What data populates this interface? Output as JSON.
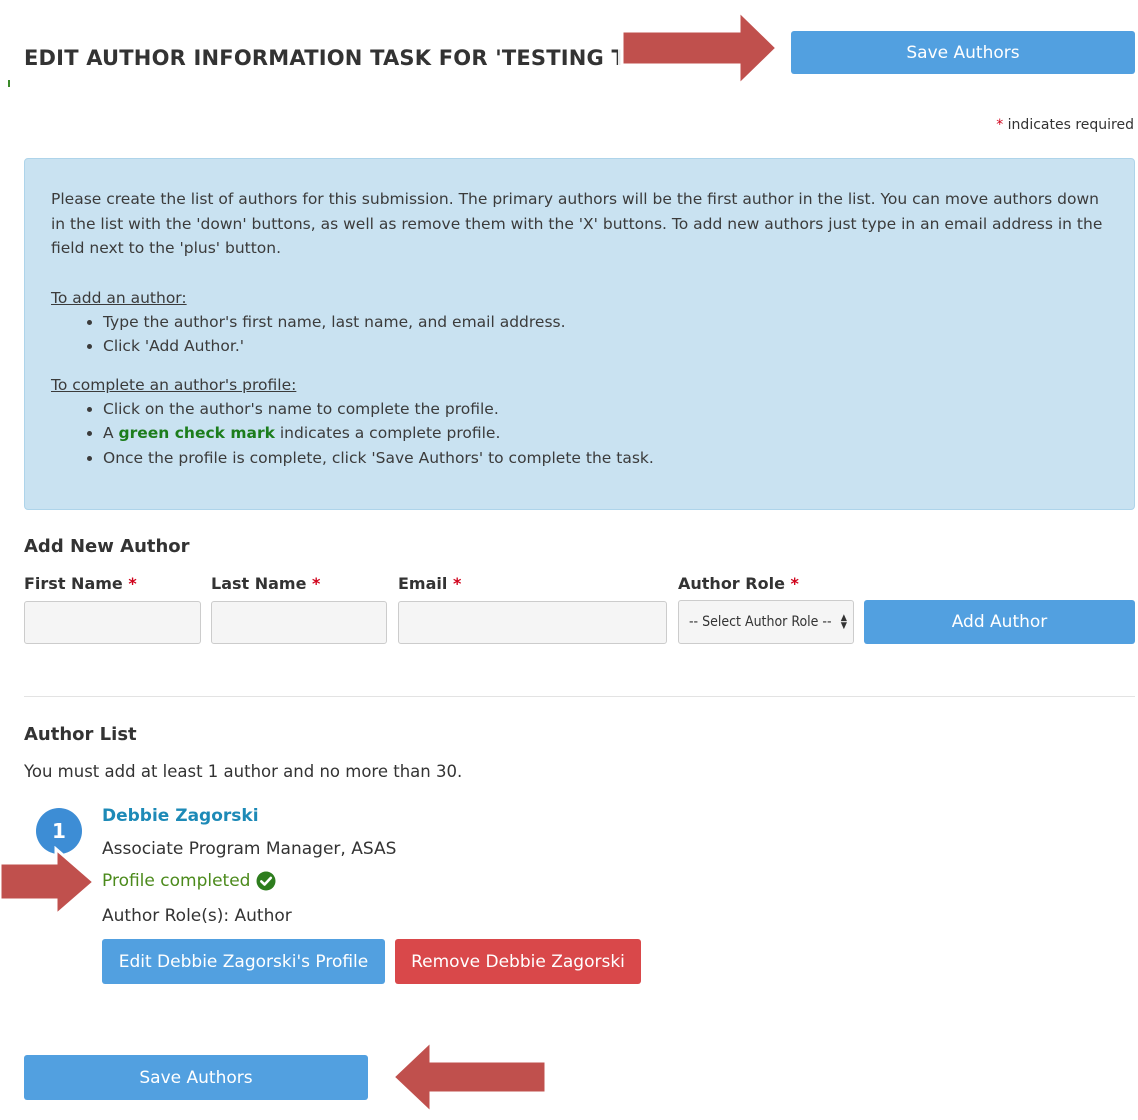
{
  "header": {
    "title": "EDIT AUTHOR INFORMATION TASK FOR 'TESTING THE SYSTEM'",
    "save_label": "Save Authors",
    "required_star": "*",
    "required_note": " indicates required"
  },
  "instructions": {
    "intro": "Please create the list of authors for this submission. The primary authors will be the first author in the list. You can move authors down in the list with the 'down' buttons, as well as remove them with the 'X' buttons. To add new authors just type in an email address in the field next to the 'plus' button.",
    "add_heading": "To add an author:",
    "add_steps": [
      "Type the author's first name, last name, and email address.",
      "Click 'Add Author.'"
    ],
    "profile_heading": "To complete an author's profile:",
    "profile_step1": "Click on the author's name to complete the profile.",
    "profile_step2_prefix": "A ",
    "profile_step2_highlight": "green check mark",
    "profile_step2_suffix": " indicates a complete profile.",
    "profile_step3": "Once the profile is complete, click 'Save Authors' to complete the task."
  },
  "add_author": {
    "heading": "Add New Author",
    "first_name_label": "First Name",
    "last_name_label": "Last Name",
    "email_label": "Email",
    "role_label": "Author Role",
    "required_star": "*",
    "first_name_value": "",
    "last_name_value": "",
    "email_value": "",
    "role_selected": "-- Select Author Role --",
    "add_button_label": "Add Author"
  },
  "author_list": {
    "heading": "Author List",
    "note": "You must add at least 1 author and no more than 30.",
    "authors": [
      {
        "number": "1",
        "name": "Debbie Zagorski",
        "title": "Associate Program Manager, ASAS",
        "status": "Profile completed",
        "roles": "Author Role(s): Author",
        "edit_label": "Edit Debbie Zagorski's Profile",
        "remove_label": "Remove Debbie Zagorski"
      }
    ]
  },
  "footer": {
    "save_label": "Save Authors"
  },
  "colors": {
    "primary_button": "#52a0e0",
    "danger_button": "#d9484a",
    "info_background": "#c9e2f1",
    "annotation_arrow": "#c0504d",
    "success_text": "#4b8a1b"
  }
}
